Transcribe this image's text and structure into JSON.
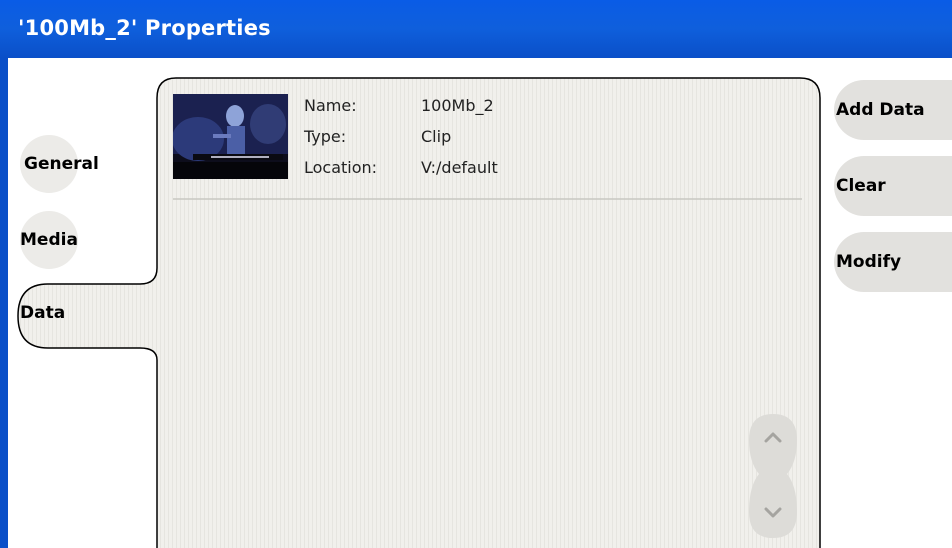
{
  "window": {
    "title": "'100Mb_2' Properties"
  },
  "tabs": [
    {
      "label": "General"
    },
    {
      "label": "Media"
    },
    {
      "label": "Data"
    }
  ],
  "info": {
    "name_label": "Name:",
    "name_value": "100Mb_2",
    "type_label": "Type:",
    "type_value": "Clip",
    "location_label": "Location:",
    "location_value": "V:/default"
  },
  "actions": [
    {
      "label": "Add Data"
    },
    {
      "label": "Clear"
    },
    {
      "label": "Modify"
    }
  ]
}
